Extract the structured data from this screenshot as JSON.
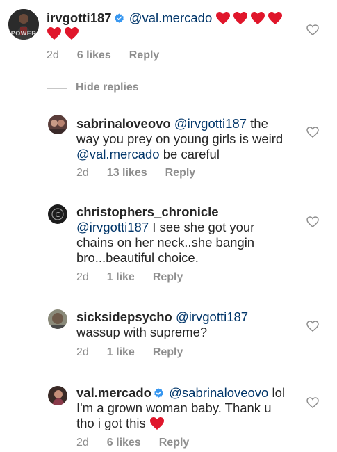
{
  "comments": [
    {
      "username": "irvgotti187",
      "verified": true,
      "mention": "@val.mercado",
      "text": "",
      "hearts_line1": 4,
      "hearts_line2": 2,
      "time": "2d",
      "likes": "6 likes",
      "reply": "Reply",
      "avatar_caption": "POWER"
    },
    {
      "username": "sabrinaloveovo",
      "mention": "@irvgotti187",
      "text_line1_tail": "the",
      "text_line2": "way you prey on young girls is weird",
      "mention2": "@val.mercado",
      "text_line3_tail": "be careful",
      "time": "2d",
      "likes": "13 likes",
      "reply": "Reply"
    },
    {
      "username": "christophers_chronicle",
      "mention": "@irvgotti187",
      "text_line2_tail": "I see she got your",
      "text_line3": "chains on her neck..she bangin",
      "text_line4": "bro...beautiful choice.",
      "time": "2d",
      "likes": "1 like",
      "reply": "Reply"
    },
    {
      "username": "sicksidepsycho",
      "mention": "@irvgotti187",
      "text_line2": "wassup with supreme?",
      "time": "2d",
      "likes": "1 like",
      "reply": "Reply"
    },
    {
      "username": "val.mercado",
      "verified": true,
      "mention": "@sabrinaloveovo",
      "text_line1_tail": "lol",
      "text_line2": "I'm a grown woman baby. Thank u",
      "text_line3": "tho i got this",
      "time": "2d",
      "likes": "6 likes",
      "reply": "Reply"
    }
  ],
  "hide_replies": "Hide replies",
  "colors": {
    "text": "#262626",
    "mention": "#003569",
    "meta": "#8e8e8e",
    "verified": "#3897f0",
    "heart": "#e0162b"
  },
  "icons": {
    "like": "heart-outline-icon",
    "verified": "verified-badge-icon",
    "emoji": "red-heart-emoji"
  }
}
